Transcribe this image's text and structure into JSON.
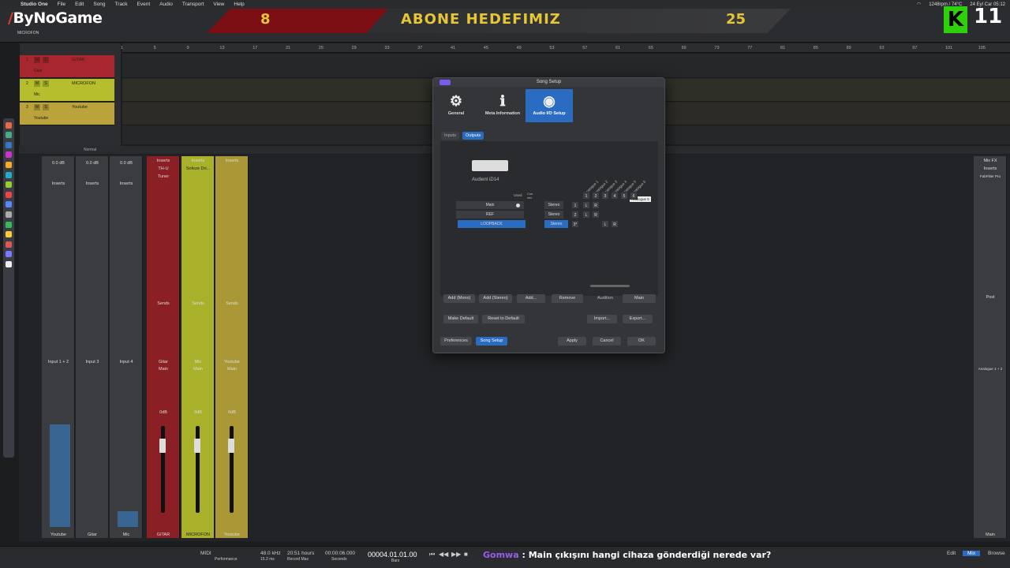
{
  "menubar": {
    "app_name": "Studio One",
    "items": [
      "File",
      "Edit",
      "Song",
      "Track",
      "Event",
      "Audio",
      "Transport",
      "View",
      "Help"
    ],
    "status_right": [
      "1248rpm / 74°C",
      "24 Eyl Car 05:12"
    ]
  },
  "overlay": {
    "logo": "ByNoGame",
    "goal_current": "8",
    "goal_title": "ABONE HEDEFIMIZ",
    "goal_target": "25",
    "kick_letter": "K",
    "kick_count": "11",
    "colors": {
      "banner_red": "#7b0f14",
      "banner_text": "#e6c637",
      "kick_green": "#2ed00c"
    }
  },
  "toolbar": {
    "track_name": "MICROFON",
    "control_label": "Control"
  },
  "tracks": [
    {
      "num": "1",
      "name": "GITAR",
      "input": "Gitar",
      "mode": "Mono",
      "color": "#a8262d"
    },
    {
      "num": "2",
      "name": "MICROFON",
      "input": "Mic",
      "mode": "Mono",
      "color": "#b7be2d"
    },
    {
      "num": "3",
      "name": "Youtube",
      "input": "Youtube",
      "mode": "Stereo",
      "color": "#b9a33a"
    }
  ],
  "ruler": [
    "1",
    "5",
    "9",
    "13",
    "17",
    "21",
    "25",
    "29",
    "33",
    "37",
    "41",
    "45",
    "49",
    "53",
    "57",
    "61",
    "65",
    "69",
    "73",
    "77",
    "81",
    "85",
    "89",
    "93",
    "97",
    "101",
    "105"
  ],
  "mixer": {
    "mode_label": "Normal",
    "inputs": [
      {
        "name": "Input 1 + 2",
        "label": "Youtube",
        "gain": "0.0 dB"
      },
      {
        "name": "Input 3",
        "label": "Gitar",
        "gain": "0.0 dB"
      },
      {
        "name": "Input 4",
        "label": "Mic",
        "gain": "0.0 dB"
      }
    ],
    "channels": [
      {
        "name": "Gitar",
        "out": "Main",
        "label": "GITAR",
        "level": "0dB",
        "insert1": "TH-U",
        "insert2": "Tuner",
        "color": "#8a1f26"
      },
      {
        "name": "Mic",
        "out": "Main",
        "label": "MICROFON",
        "level": "0dB",
        "insert1": "Sofeze Dri...",
        "color": "#a9b02a"
      },
      {
        "name": "Youtube",
        "out": "Main",
        "label": "Youtube",
        "level": "0dB",
        "color": "#aa9736"
      }
    ],
    "inserts_label": "Inserts",
    "sends_label": "Sends",
    "main": {
      "name": "Analogue 1 + 2",
      "label": "Main",
      "insert": "FabFilter Pro",
      "mix_fx": "Mix FX",
      "post": "Post"
    }
  },
  "dialog": {
    "title": "Song Setup",
    "tabs": [
      {
        "label": "General",
        "icon": "gear-icon"
      },
      {
        "label": "Meta Information",
        "icon": "info-icon"
      },
      {
        "label": "Audio I/O Setup",
        "icon": "audio-io-icon"
      }
    ],
    "subtabs": [
      "Inputs",
      "Outputs"
    ],
    "device": "Audient iD14",
    "used_label": "Used",
    "cue_label": "Cue mix",
    "columns": [
      "Analogue 1",
      "Analogue 2",
      "Analogue 3",
      "Analogue 4",
      "Analogue 5",
      "Analogue 6"
    ],
    "col_nums": [
      "1",
      "2",
      "3",
      "4",
      "5",
      "6"
    ],
    "tooltip": "Analogue 5",
    "outputs": [
      {
        "name": "Main",
        "type": "Stereo",
        "idx": "1",
        "l": "L",
        "r": "R"
      },
      {
        "name": "REF",
        "type": "Stereo",
        "idx": "2",
        "l": "L",
        "r": "R"
      },
      {
        "name": "LOOPBACK",
        "type": "Stereo",
        "idx": "3*",
        "l": "L",
        "r": "R"
      }
    ],
    "buttons": {
      "add_mono": "Add (Mono)",
      "add_stereo": "Add (Stereo)",
      "add": "Add...",
      "remove": "Remove",
      "audition": "Audition",
      "audition_value": "Main",
      "make_default": "Make Default",
      "reset_default": "Reset to Default",
      "import": "Import...",
      "export": "Export...",
      "preferences": "Preferences",
      "song_setup": "Song Setup",
      "apply": "Apply",
      "cancel": "Cancel",
      "ok": "OK"
    }
  },
  "transport": {
    "sample_rate": "48.0 kHz",
    "latency": "15.2 ms",
    "record_max": "20:51 hours",
    "record_max_label": "Record Max",
    "seconds": "00:00:06.000",
    "seconds_label": "Seconds",
    "position": "00004.01.01.00",
    "bars_label": "Bars",
    "midi": "MIDI",
    "perf": "Performance",
    "edit": "Edit",
    "mix": "Mix",
    "browse": "Browse"
  },
  "chat": {
    "user": "Gomwa",
    "message": "Main çıkışını hangi cihaza gönderdiği nerede var?"
  }
}
